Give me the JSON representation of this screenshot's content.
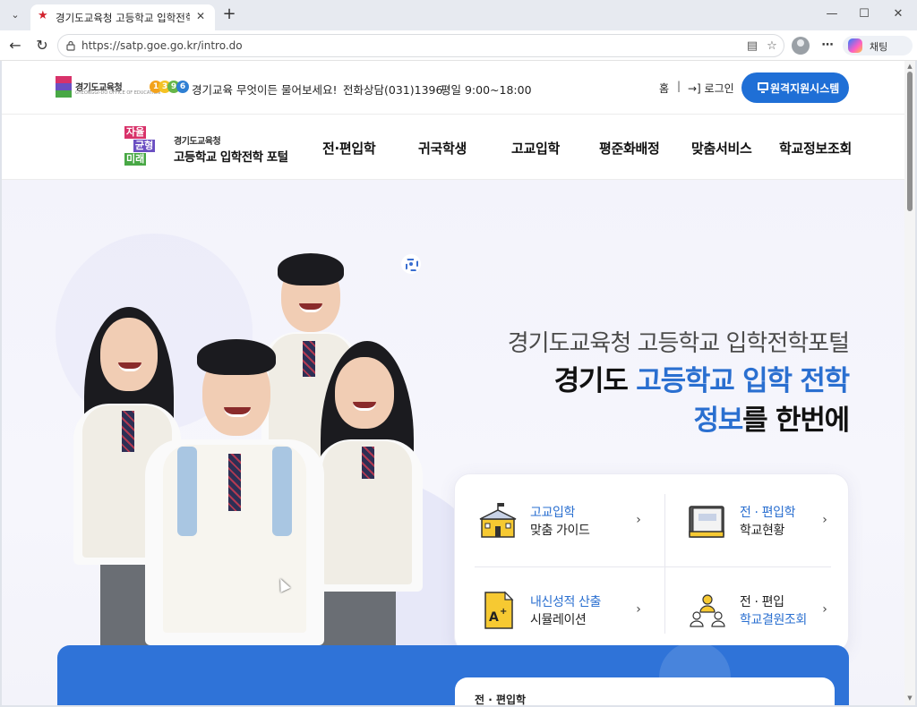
{
  "browser": {
    "tab_title": "경기도교육청 고등학교 입학전학 포",
    "url": "https://satp.goe.go.kr/intro.do",
    "copilot_label": "채팅"
  },
  "utility": {
    "logo_text": "경기도교육청",
    "logo_sub": "GYEONGGI-DO OFFICE OF EDUCATION",
    "call_badge": [
      "1",
      "3",
      "9",
      "6"
    ],
    "call_text": "경기교육 무엇이든 물어보세요!",
    "phone_text": "전화상담(031)1396",
    "hours_text": "평일 9:00~18:00",
    "home_link": "홈",
    "separator": "|",
    "login_link": "→] 로그인",
    "remote_button": "원격지원시스템"
  },
  "site": {
    "logo_mark": [
      "자율",
      "균형",
      "미래"
    ],
    "logo_org": "경기도교육청",
    "logo_name": "고등학교 입학전학 포털"
  },
  "nav": {
    "items": [
      "전·편입학",
      "귀국학생",
      "고교입학",
      "평준화배정",
      "맞춤서비스",
      "학교정보조회"
    ]
  },
  "hero": {
    "subtitle": "경기도교육청 고등학교 입학전학포털",
    "title_line1_a": "경기도 ",
    "title_line1_b": "고등학교 입학 전학",
    "title_line2_a": "정보",
    "title_line2_b": "를 한번에"
  },
  "quick_menu": [
    {
      "line1": "고교입학",
      "line2": "맞춤 가이드",
      "icon": "school-icon"
    },
    {
      "line1": "전 · 편입학",
      "line2": "학교현황",
      "icon": "book-icon"
    },
    {
      "line1": "내신성적 산출",
      "line2": "시뮬레이션",
      "icon": "grade-document-icon"
    },
    {
      "line1": "전 · 편입",
      "line2": "학교결원조회",
      "icon": "people-icon"
    }
  ],
  "section": {
    "card_label": "전 · 편입학"
  },
  "colors": {
    "accent": "#2a6fd0",
    "button": "#1f6fd6",
    "section": "#2f73d8"
  }
}
